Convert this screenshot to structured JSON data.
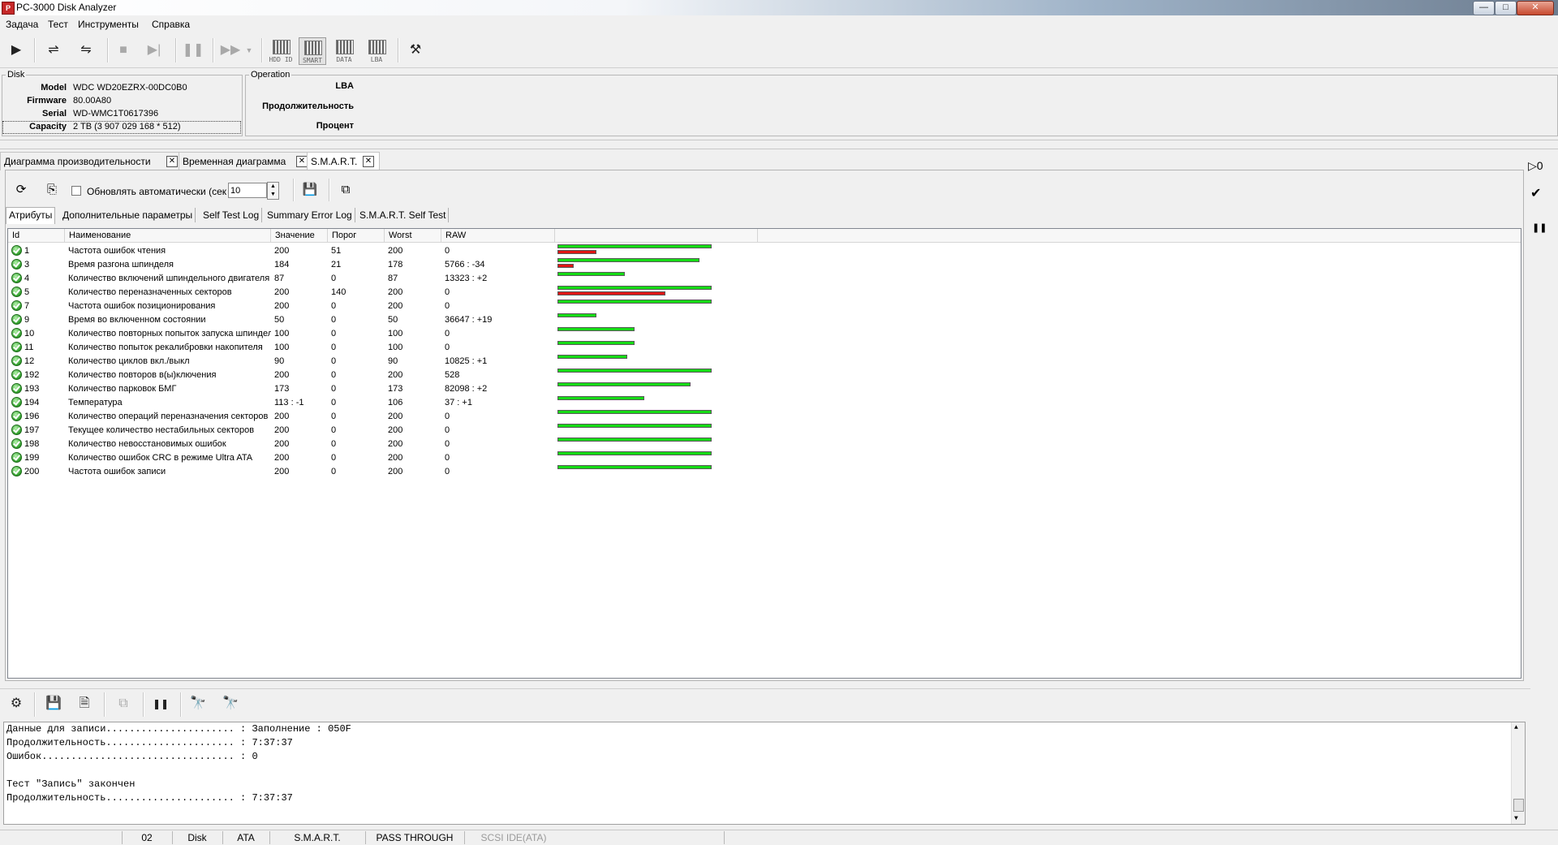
{
  "window": {
    "title": "PC-3000 Disk Analyzer",
    "minimize": "—",
    "maximize": "□",
    "close": "✕"
  },
  "menu": [
    "Задача",
    "Тест",
    "Инструменты",
    "Справка"
  ],
  "toolbar": {
    "hdd_id": "HDD ID",
    "smart": "SMART",
    "data": "DATA",
    "lba": "LBA"
  },
  "disk": {
    "legend": "Disk",
    "model_label": "Model",
    "model": "WDC WD20EZRX-00DC0B0",
    "firmware_label": "Firmware",
    "firmware": "80.00A80",
    "serial_label": "Serial",
    "serial": "WD-WMC1T0617396",
    "capacity_label": "Capacity",
    "capacity": "2 TB (3 907 029 168 * 512)"
  },
  "operation": {
    "legend": "Operation",
    "lba_label": "LBA",
    "duration_label": "Продолжительность",
    "percent_label": "Процент"
  },
  "tabs": [
    {
      "label": "Диаграмма производительности",
      "close": "✕"
    },
    {
      "label": "Временная диаграмма",
      "close": "✕"
    },
    {
      "label": "S.M.A.R.T.",
      "close": "✕"
    }
  ],
  "smart_toolbar": {
    "auto_update_label": "Обновлять автоматически (сек",
    "interval": "10"
  },
  "subtabs": [
    "Атрибуты",
    "Дополнительные параметры",
    "Self Test Log",
    "Summary Error Log",
    "S.M.A.R.T. Self Test"
  ],
  "columns": [
    "Id",
    "Наименование",
    "Значение",
    "Порог",
    "Worst",
    "RAW"
  ],
  "rows": [
    {
      "id": "1",
      "name": "Частота ошибок чтения",
      "value": "200",
      "threshold": "51",
      "worst": "200",
      "raw": "0",
      "bar_value": 200,
      "bar_thresh": 51
    },
    {
      "id": "3",
      "name": "Время разгона шпинделя",
      "value": "184",
      "threshold": "21",
      "worst": "178",
      "raw": "5766 : -34",
      "bar_value": 184,
      "bar_thresh": 21
    },
    {
      "id": "4",
      "name": "Количество включений шпиндельного двигателя",
      "value": "87",
      "threshold": "0",
      "worst": "87",
      "raw": "13323 : +2",
      "bar_value": 87,
      "bar_thresh": 0
    },
    {
      "id": "5",
      "name": "Количество переназначенных секторов",
      "value": "200",
      "threshold": "140",
      "worst": "200",
      "raw": "0",
      "bar_value": 200,
      "bar_thresh": 140
    },
    {
      "id": "7",
      "name": "Частота ошибок позиционирования",
      "value": "200",
      "threshold": "0",
      "worst": "200",
      "raw": "0",
      "bar_value": 200,
      "bar_thresh": 0
    },
    {
      "id": "9",
      "name": "Время во включенном состоянии",
      "value": "50",
      "threshold": "0",
      "worst": "50",
      "raw": "36647 : +19",
      "bar_value": 50,
      "bar_thresh": 0
    },
    {
      "id": "10",
      "name": "Количество повторных попыток запуска шпинделя",
      "value": "100",
      "threshold": "0",
      "worst": "100",
      "raw": "0",
      "bar_value": 100,
      "bar_thresh": 0
    },
    {
      "id": "11",
      "name": "Количество попыток рекалибровки накопителя",
      "value": "100",
      "threshold": "0",
      "worst": "100",
      "raw": "0",
      "bar_value": 100,
      "bar_thresh": 0
    },
    {
      "id": "12",
      "name": "Количество циклов вкл./выкл",
      "value": "90",
      "threshold": "0",
      "worst": "90",
      "raw": "10825 : +1",
      "bar_value": 90,
      "bar_thresh": 0
    },
    {
      "id": "192",
      "name": "Количество повторов в(ы)ключения",
      "value": "200",
      "threshold": "0",
      "worst": "200",
      "raw": "528",
      "bar_value": 200,
      "bar_thresh": 0
    },
    {
      "id": "193",
      "name": "Количество парковок БМГ",
      "value": "173",
      "threshold": "0",
      "worst": "173",
      "raw": "82098 : +2",
      "bar_value": 173,
      "bar_thresh": 0
    },
    {
      "id": "194",
      "name": "Температура",
      "value": "113 : -1",
      "threshold": "0",
      "worst": "106",
      "raw": "37 : +1",
      "bar_value": 113,
      "bar_thresh": 0
    },
    {
      "id": "196",
      "name": "Количество операций переназначения секторов",
      "value": "200",
      "threshold": "0",
      "worst": "200",
      "raw": "0",
      "bar_value": 200,
      "bar_thresh": 0
    },
    {
      "id": "197",
      "name": "Текущее количество нестабильных секторов",
      "value": "200",
      "threshold": "0",
      "worst": "200",
      "raw": "0",
      "bar_value": 200,
      "bar_thresh": 0
    },
    {
      "id": "198",
      "name": "Количество невосстановимых ошибок",
      "value": "200",
      "threshold": "0",
      "worst": "200",
      "raw": "0",
      "bar_value": 200,
      "bar_thresh": 0
    },
    {
      "id": "199",
      "name": "Количество ошибок CRC в режиме Ultra ATA",
      "value": "200",
      "threshold": "0",
      "worst": "200",
      "raw": "0",
      "bar_value": 200,
      "bar_thresh": 0
    },
    {
      "id": "200",
      "name": "Частота ошибок записи",
      "value": "200",
      "threshold": "0",
      "worst": "200",
      "raw": "0",
      "bar_value": 200,
      "bar_thresh": 0
    }
  ],
  "log": [
    "Данные для записи...................... : Заполнение : 050F",
    "Продолжительность...................... : 7:37:37",
    "Ошибок................................. : 0",
    "",
    "Тест \"Запись\" закончен",
    "Продолжительность...................... : 7:37:37"
  ],
  "status": [
    "02",
    "Disk",
    "ATA",
    "S.M.A.R.T.",
    "PASS THROUGH",
    "SCSI IDE(ATA)"
  ],
  "colors": {
    "bar_value": "#16dc16",
    "bar_threshold": "#e01515"
  }
}
